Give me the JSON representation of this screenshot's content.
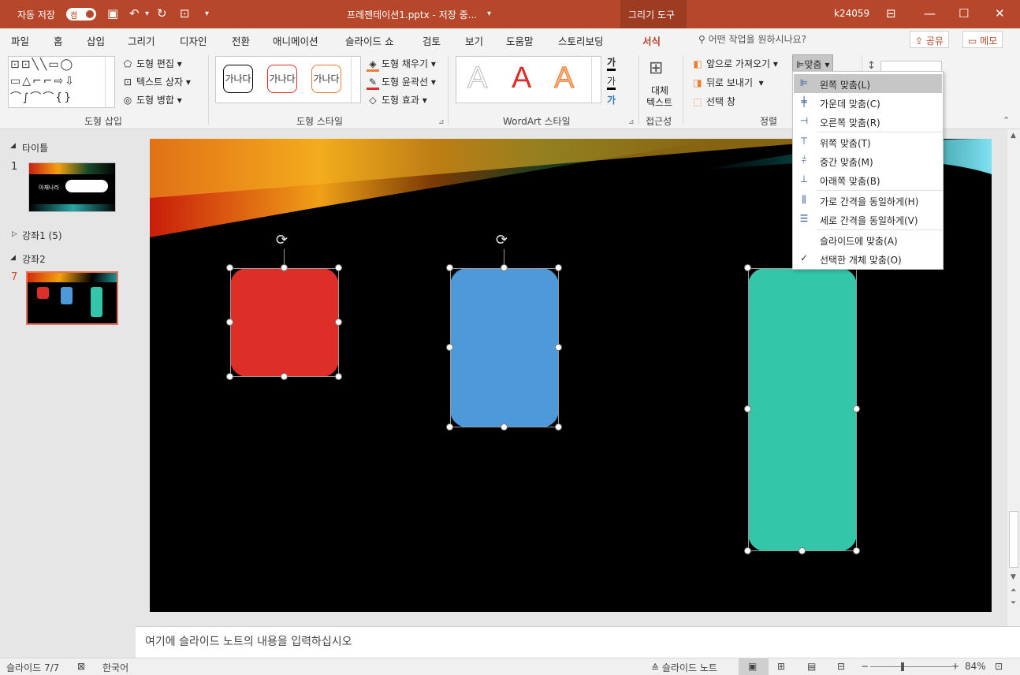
{
  "titlebar": {
    "autosave_label": "자동 저장",
    "autosave_state": "켬",
    "document_title": "프레젠테이션1.pptx - 저장 중...",
    "context_tab": "그리기 도구",
    "user": "k24059"
  },
  "tabs": [
    "파일",
    "홈",
    "삽입",
    "그리기",
    "디자인",
    "전환",
    "애니메이션",
    "슬라이드 쇼",
    "검토",
    "보기",
    "도움말",
    "스토리보딩",
    "서식"
  ],
  "active_tab": "서식",
  "search_placeholder": "어떤 작업을 원하시나요?",
  "share_label": "공유",
  "comment_label": "메모",
  "ribbon": {
    "insert_shapes": {
      "label": "도형 삽입",
      "edit_shape": "도형 편집",
      "text_box": "텍스트 상자",
      "merge_shapes": "도형 병합"
    },
    "shape_styles": {
      "label": "도형 스타일",
      "presets": [
        "가나다",
        "가나다",
        "가나다"
      ],
      "fill": "도형 채우기",
      "outline": "도형 윤곽선",
      "effects": "도형 효과"
    },
    "wordart": {
      "label": "WordArt 스타일",
      "letters": [
        "A",
        "A",
        "A"
      ],
      "text_fill_glyph": "가",
      "text_outline_glyph": "가",
      "text_effect_glyph": "가"
    },
    "accessibility": {
      "label": "접근성",
      "alt_text_line1": "대체",
      "alt_text_line2": "텍스트"
    },
    "arrange": {
      "label": "정렬",
      "bring_forward": "앞으로 가져오기",
      "send_backward": "뒤로 보내기",
      "selection_pane": "선택 창",
      "align": "맞춤"
    }
  },
  "align_menu": [
    {
      "label": "왼쪽 맞춤(L)",
      "icon": "align-left-icon",
      "highlighted": true
    },
    {
      "label": "가운데 맞춤(C)",
      "icon": "align-center-icon"
    },
    {
      "label": "오른쪽 맞춤(R)",
      "icon": "align-right-icon"
    },
    {
      "label": "위쪽 맞춤(T)",
      "icon": "align-top-icon"
    },
    {
      "label": "중간 맞춤(M)",
      "icon": "align-middle-icon"
    },
    {
      "label": "아래쪽 맞춤(B)",
      "icon": "align-bottom-icon"
    },
    {
      "label": "가로 간격을 동일하게(H)",
      "icon": "distribute-horizontal-icon"
    },
    {
      "label": "세로 간격을 동일하게(V)",
      "icon": "distribute-vertical-icon"
    },
    {
      "label": "슬라이드에 맞춤(A)",
      "icon": ""
    },
    {
      "label": "선택한 개체 맞춤(O)",
      "icon": "checkmark-icon",
      "checked": true
    }
  ],
  "slides_panel": {
    "section1": "타이틀",
    "slide1_number": "1",
    "slide1_thumb_text": "아재나라",
    "section2": "강좌1 (5)",
    "section3": "강좌2",
    "slide7_number": "7"
  },
  "slide": {
    "shapes": [
      {
        "name": "red-rectangle",
        "color": "#dd2e27"
      },
      {
        "name": "blue-rectangle",
        "color": "#4e99d9"
      },
      {
        "name": "teal-rectangle",
        "color": "#33c6a8"
      }
    ]
  },
  "notes_placeholder": "여기에 슬라이드 노트의 내용을 입력하십시오",
  "status": {
    "slide_counter": "슬라이드 7/7",
    "language": "한국어",
    "notes_button": "슬라이드 노트",
    "zoom": "84%"
  },
  "colors": {
    "accent": "#b7472a",
    "context_tab_bg": "#9d3b23"
  }
}
